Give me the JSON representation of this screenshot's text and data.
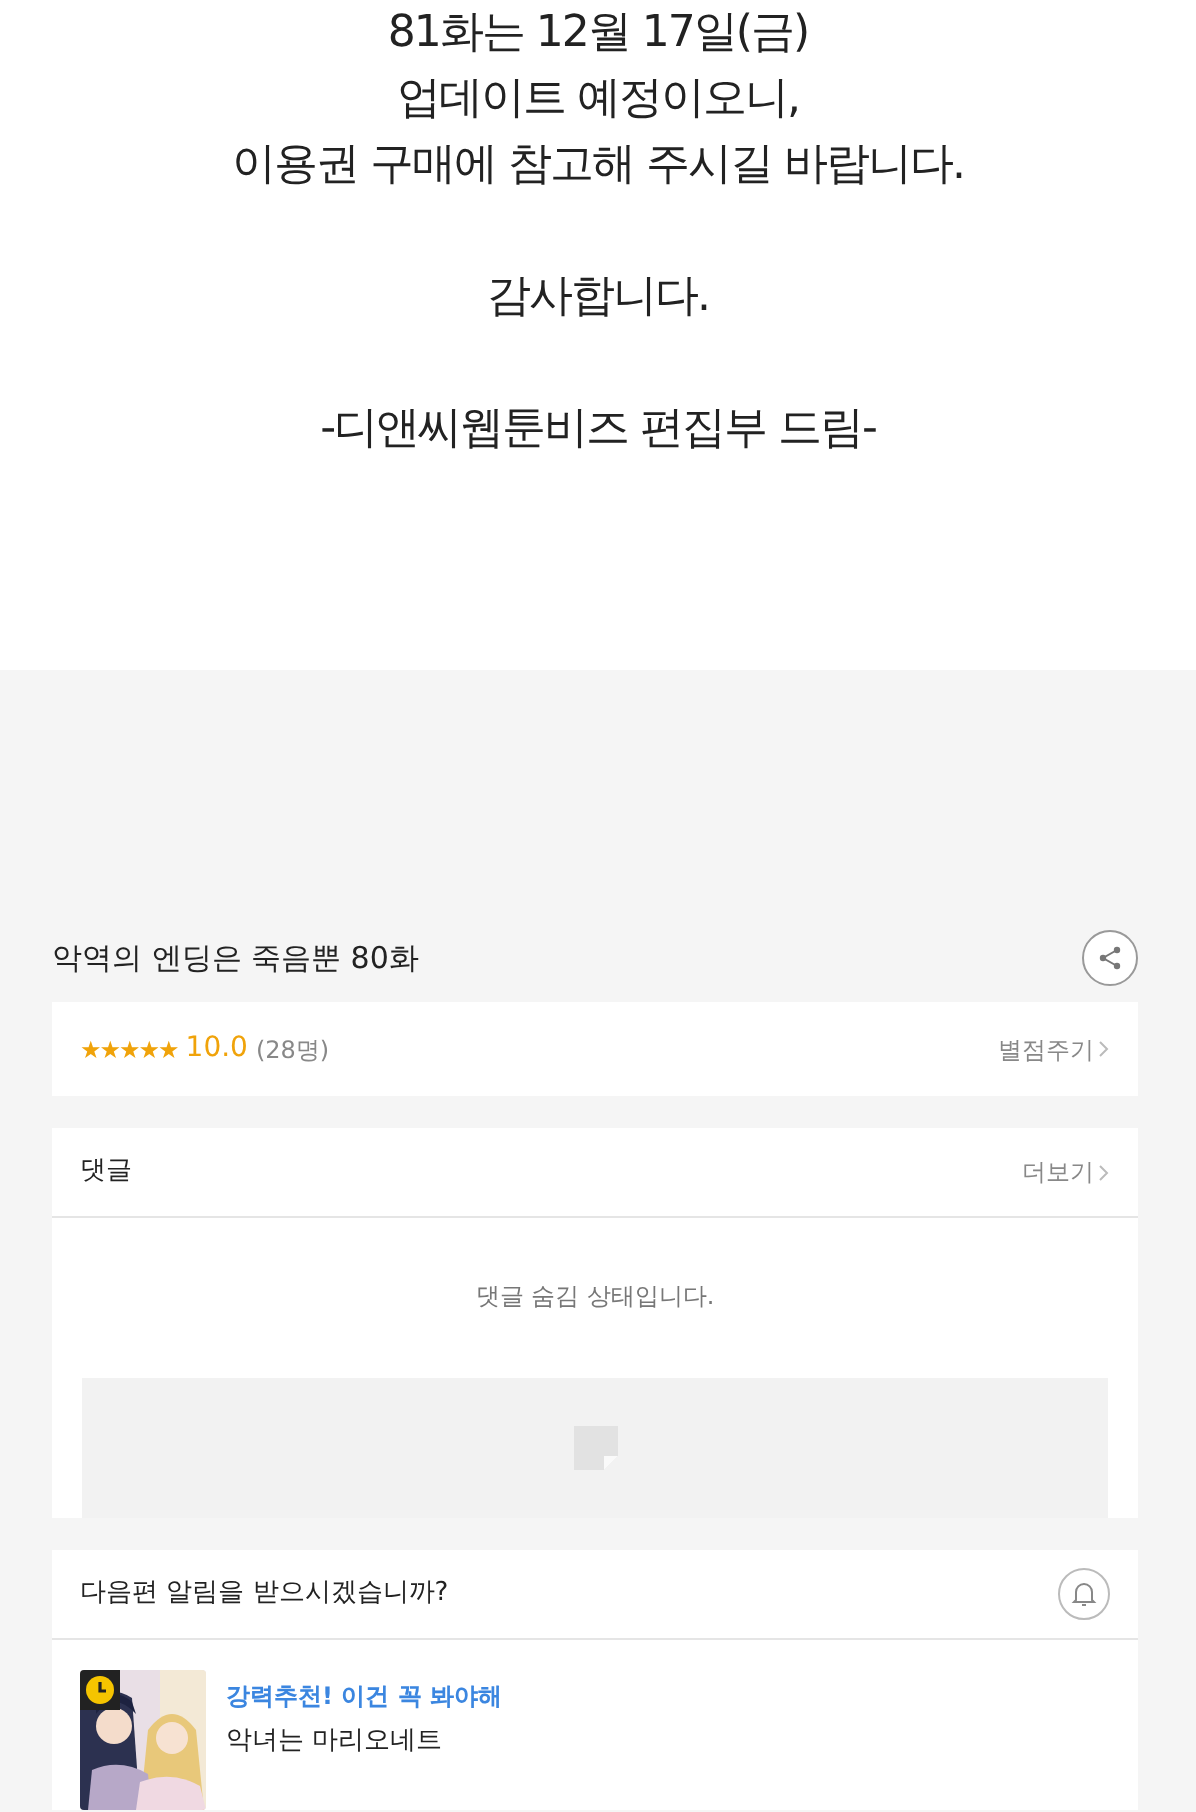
{
  "notice": {
    "paragraphs": [
      {
        "lines": [
          "81화는 12월 17일(금)",
          "업데이트 예정이오니,",
          "이용권 구매에 참고해 주시길 바랍니다."
        ]
      },
      {
        "lines": [
          "감사합니다."
        ]
      },
      {
        "lines": [
          "-디앤씨웹툰비즈 편집부 드림-"
        ]
      }
    ]
  },
  "episode": {
    "title": "악역의 엔딩은 죽음뿐 80화"
  },
  "rating": {
    "stars": 5,
    "score": "10.0",
    "count": "(28명)",
    "action": "별점주기"
  },
  "comments": {
    "title": "댓글",
    "more": "더보기",
    "message": "댓글 숨김 상태입니다."
  },
  "notification": {
    "question": "다음편 알림을 받으시겠습니까?"
  },
  "recommendation": {
    "kind": "picture",
    "tagline": "강력추천! 이건 꼭 봐야해",
    "title": "악녀는 마리오네트"
  }
}
